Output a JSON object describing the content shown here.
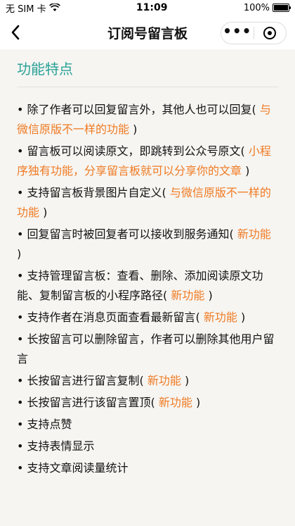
{
  "status": {
    "carrier": "无 SIM 卡",
    "time": "11:09",
    "battery_pct": "100%"
  },
  "nav": {
    "title": "订阅号留言板"
  },
  "section": {
    "title": "功能特点"
  },
  "features": [
    {
      "text": "• 除了作者可以回复留言外，其他人也可以回复(",
      "highlight": " 与微信原版不一样的功能 ",
      "after": ")"
    },
    {
      "text": "• 留言板可以阅读原文，即跳转到公众号原文(",
      "highlight": " 小程序独有功能，分享留言板就可以分享你的文章 ",
      "after": ")"
    },
    {
      "text": "• 支持留言板背景图片自定义(",
      "highlight": " 与微信原版不一样的功能 ",
      "after": ")"
    },
    {
      "text": "• 回复留言时被回复者可以接收到服务通知(",
      "highlight": " 新功能 ",
      "after": ")"
    },
    {
      "text": "• 支持管理留言板：查看、删除、添加阅读原文功能、复制留言板的小程序路径(",
      "highlight": " 新功能 ",
      "after": ")"
    },
    {
      "text": "• 支持作者在消息页面查看最新留言(",
      "highlight": " 新功能 ",
      "after": ")"
    },
    {
      "text": "• 长按留言可以删除留言，作者可以删除其他用户留言",
      "highlight": "",
      "after": ""
    },
    {
      "text": "• 长按留言进行留言复制(",
      "highlight": " 新功能 ",
      "after": ")"
    },
    {
      "text": "• 长按留言进行该留言置顶(",
      "highlight": " 新功能 ",
      "after": ")"
    },
    {
      "text": "• 支持点赞",
      "highlight": "",
      "after": ""
    },
    {
      "text": "• 支持表情显示",
      "highlight": "",
      "after": ""
    },
    {
      "text": "• 支持文章阅读量统计",
      "highlight": "",
      "after": ""
    }
  ],
  "colors": {
    "accent": "#2aa197",
    "highlight": "#f07a22"
  }
}
